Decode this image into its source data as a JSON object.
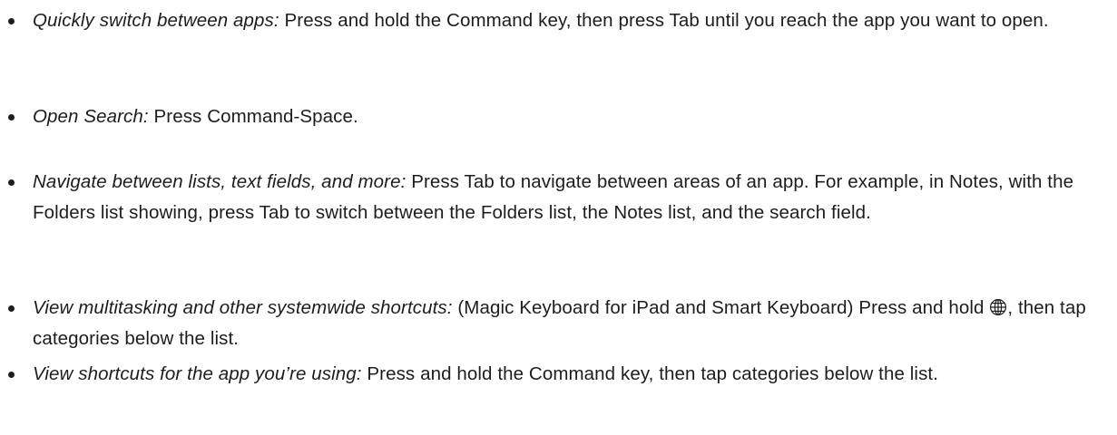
{
  "items": [
    {
      "term": "Quickly switch between apps:",
      "text": "Press and hold the Command key, then press Tab until you reach the app you want to open."
    },
    {
      "term": "Open Search:",
      "text": "Press Command-Space."
    },
    {
      "term": "Navigate between lists, text fields, and more:",
      "text": "Press Tab to navigate between areas of an app. For example, in Notes, with the Folders list showing, press Tab to switch between the Folders list, the Notes list, and the search field."
    },
    {
      "term": "View multitasking and other systemwide shortcuts:",
      "text_before_icon": "(Magic Keyboard for iPad and Smart Keyboard) Press and hold",
      "icon": "globe-icon",
      "text_after_icon": ", then tap categories below the list."
    },
    {
      "term": "View shortcuts for the app you’re using:",
      "text": "Press and hold the Command key, then tap categories below the list."
    }
  ]
}
